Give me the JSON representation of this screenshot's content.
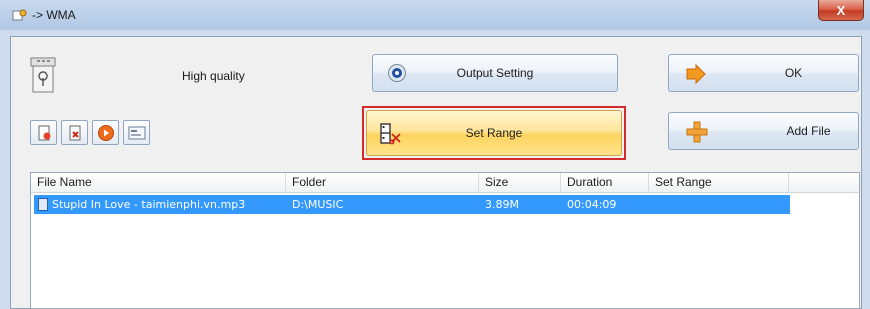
{
  "window": {
    "title": "-> WMA",
    "close_label": "X"
  },
  "quality": {
    "label": "High quality",
    "icon": "settings-sheet-icon"
  },
  "buttons": {
    "output_setting": "Output Setting",
    "ok": "OK",
    "set_range": "Set Range",
    "add_file": "Add File"
  },
  "toolbar_icons": [
    "new-file-icon",
    "remove-file-icon",
    "play-icon",
    "properties-icon"
  ],
  "table": {
    "columns": [
      "File Name",
      "Folder",
      "Size",
      "Duration",
      "Set Range"
    ],
    "rows": [
      {
        "file_name": "Stupid In Love - taimienphi.vn.mp3",
        "folder": "D:\\MUSIC",
        "size": "3.89M",
        "duration": "00:04:09",
        "set_range": ""
      }
    ]
  },
  "colors": {
    "selection": "#3399ff",
    "highlight_border": "#d32a2a",
    "hot_button": "#ffd45f"
  }
}
